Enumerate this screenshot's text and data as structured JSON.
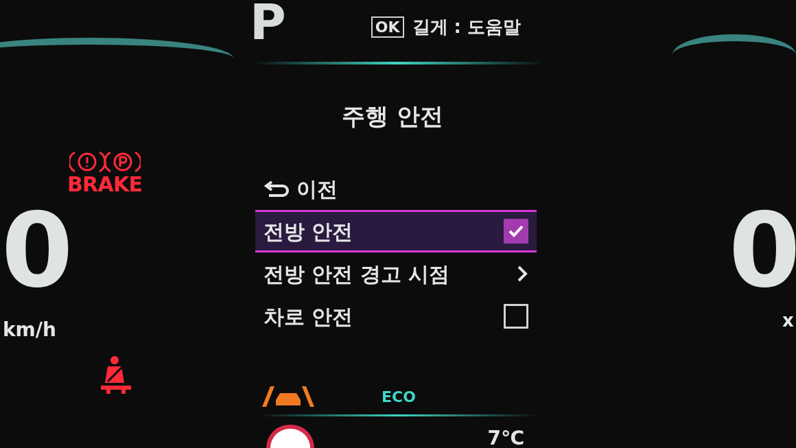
{
  "gear": "P",
  "hint": {
    "key": "OK",
    "text": "길게 : 도움말"
  },
  "menu": {
    "title": "주행 안전",
    "items": [
      {
        "kind": "back",
        "label": "이전",
        "selected": false
      },
      {
        "kind": "check",
        "label": "전방 안전",
        "checked": true,
        "selected": true
      },
      {
        "kind": "submenu",
        "label": "전방 안전 경고 시점",
        "selected": false
      },
      {
        "kind": "check",
        "label": "차로 안전",
        "checked": false,
        "selected": false
      }
    ]
  },
  "speed": {
    "value": "0",
    "unit": "km/h"
  },
  "warning": {
    "label": "BRAKE"
  },
  "drive_mode": "ECO",
  "temperature": "7℃",
  "right_gauge": {
    "value": "0",
    "unit": "x"
  }
}
